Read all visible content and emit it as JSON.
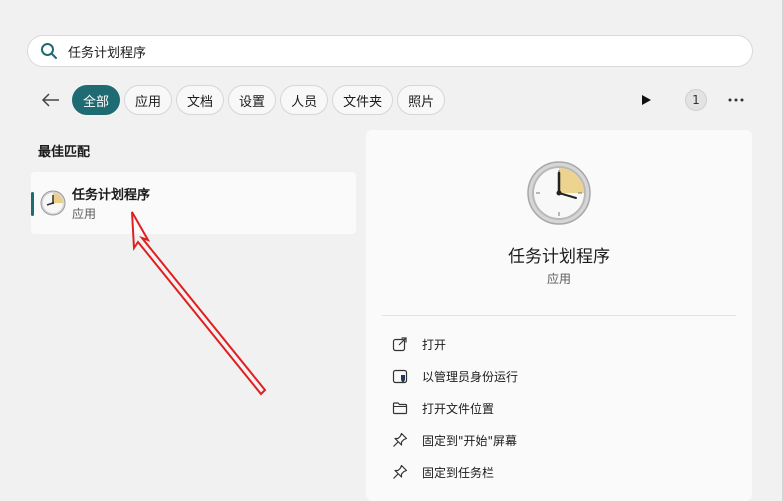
{
  "search": {
    "value": "任务计划程序"
  },
  "filters": {
    "chips": [
      {
        "label": "全部",
        "active": true
      },
      {
        "label": "应用"
      },
      {
        "label": "文档"
      },
      {
        "label": "设置"
      },
      {
        "label": "人员"
      },
      {
        "label": "文件夹"
      },
      {
        "label": "照片"
      }
    ],
    "count": "1"
  },
  "results": {
    "section_title": "最佳匹配",
    "best_match": {
      "title": "任务计划程序",
      "subtitle": "应用"
    }
  },
  "detail": {
    "name": "任务计划程序",
    "kind": "应用",
    "actions": [
      {
        "label": "打开",
        "icon": "open-external-icon"
      },
      {
        "label": "以管理员身份运行",
        "icon": "shield-admin-icon"
      },
      {
        "label": "打开文件位置",
        "icon": "folder-icon"
      },
      {
        "label": "固定到\"开始\"屏幕",
        "icon": "pin-icon"
      },
      {
        "label": "固定到任务栏",
        "icon": "pin-icon"
      }
    ]
  },
  "colors": {
    "accent": "#1f6b73",
    "annotation_arrow": "#e02020"
  }
}
